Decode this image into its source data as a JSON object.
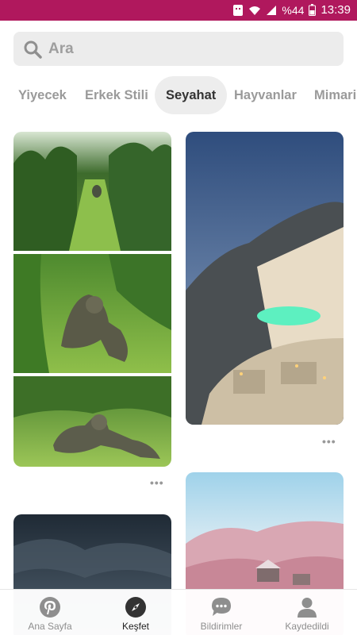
{
  "status_bar": {
    "battery_percent": "%44",
    "time": "13:39",
    "icons": [
      "notification-icon",
      "wifi-icon",
      "signal-icon",
      "battery-icon"
    ]
  },
  "search": {
    "placeholder": "Ara"
  },
  "categories": [
    {
      "label": "Yiyecek"
    },
    {
      "label": "Erkek Stili"
    },
    {
      "label": "Seyahat"
    },
    {
      "label": "Hayvanlar"
    },
    {
      "label": "Mimari"
    }
  ],
  "active_category": "Seyahat",
  "pins": [
    {
      "name": "swamp-sculptures-pin",
      "more_label": "•••"
    },
    {
      "name": "santorini-terrace-pin",
      "more_label": "•••"
    },
    {
      "name": "stormy-sky-pin"
    },
    {
      "name": "pink-snow-village-pin"
    }
  ],
  "bottom_nav": [
    {
      "label": "Ana Sayfa",
      "icon": "pinterest-icon"
    },
    {
      "label": "Keşfet",
      "icon": "compass-icon",
      "active": true
    },
    {
      "label": "Bildirimler",
      "icon": "chat-bubble-icon"
    },
    {
      "label": "Kaydedildi",
      "icon": "profile-icon"
    }
  ],
  "colors": {
    "status_bar": "#b0185d",
    "search_bg": "#ececec",
    "active_tab_bg": "#ededed"
  }
}
